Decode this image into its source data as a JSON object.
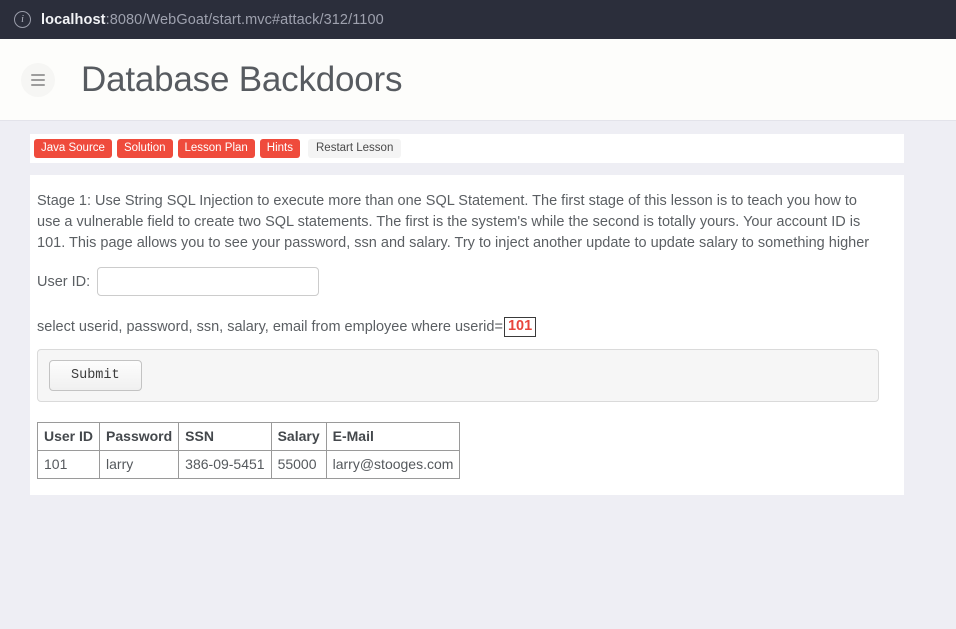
{
  "browser": {
    "info_icon": "info-circle-icon",
    "url_host": "localhost",
    "url_path": ":8080/WebGoat/start.mvc#attack/312/1100"
  },
  "header": {
    "menu_icon": "hamburger-menu-icon",
    "title": "Database Backdoors"
  },
  "toolbar": {
    "buttons": [
      {
        "label": "Java Source",
        "style": "danger"
      },
      {
        "label": "Solution",
        "style": "danger"
      },
      {
        "label": "Lesson Plan",
        "style": "danger"
      },
      {
        "label": "Hints",
        "style": "danger"
      }
    ],
    "restart_label": "Restart Lesson"
  },
  "lesson": {
    "description": "Stage 1: Use String SQL Injection to execute more than one SQL Statement. The first stage of this lesson is to teach you how to use a vulnerable field to create two SQL statements. The first is the system's while the second is totally yours. Your account ID is 101. This page allows you to see your password, ssn and salary. Try to inject another update to update salary to something higher",
    "form": {
      "user_id_label": "User ID:",
      "user_id_value": "",
      "user_id_placeholder": ""
    },
    "sql": {
      "prefix": "select userid, password, ssn, salary, email from employee where userid=",
      "value": "101"
    },
    "submit_label": "Submit"
  },
  "results": {
    "columns": [
      "User ID",
      "Password",
      "SSN",
      "Salary",
      "E-Mail"
    ],
    "rows": [
      {
        "user_id": "101",
        "password": "larry",
        "ssn": "386-09-5451",
        "salary": "55000",
        "email": "larry@stooges.com"
      }
    ]
  },
  "colors": {
    "urlbar_bg": "#2b2e3b",
    "danger": "#ef4b3c",
    "page_bg": "#eeeef4",
    "sql_value": "#e8453c"
  }
}
